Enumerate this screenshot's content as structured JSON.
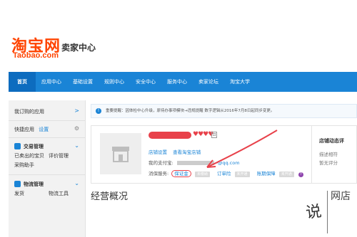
{
  "header": {
    "logo_cn": "淘宝网",
    "logo_en": "Taobao.com",
    "subtitle": "卖家中心",
    "brand_color": "#ff4400"
  },
  "nav": {
    "items": [
      "首页",
      "应用中心",
      "基础设置",
      "规则中心",
      "安全中心",
      "服务中心",
      "卖家论坛",
      "淘宝大学"
    ],
    "active": "首页",
    "bar_color": "#1a84d6"
  },
  "sidebar": {
    "my_apps": "我订购的应用",
    "quick_apps": "快捷应用",
    "settings": "设置",
    "trade_title": "交易管理",
    "trade_links": [
      "已卖出的宝贝",
      "评价管理",
      "采购助手"
    ],
    "logistics_title": "物流管理",
    "logistics_links": [
      "发货",
      "物流工具"
    ]
  },
  "notice": {
    "icon": "info-icon",
    "text": "重要提醒：因体检中心升级，原待办事项模块→违规提醒 数字逻辑从2016年7月8日起同步变更。"
  },
  "shop": {
    "links": [
      "店铺设置",
      "查看淘宝店铺"
    ],
    "alipay_label": "我的支付宝:",
    "alipay_suffix": "@qq.com",
    "consumer_label": "消保服务:",
    "deposit_link": "保证金",
    "tag_status": "未缴纳",
    "installment": "订单险",
    "tag_status2": "未开通",
    "account_security": "账期保障",
    "tag_status3": "未开通",
    "hearts": "♥♥♥♥"
  },
  "right_panel": {
    "title": "店铺动态评",
    "desc_label": "描述相符",
    "desc_value": "暂无评分"
  },
  "overview": {
    "title": "经营概况"
  },
  "watermark": {
    "left": "说",
    "right": "网店"
  }
}
